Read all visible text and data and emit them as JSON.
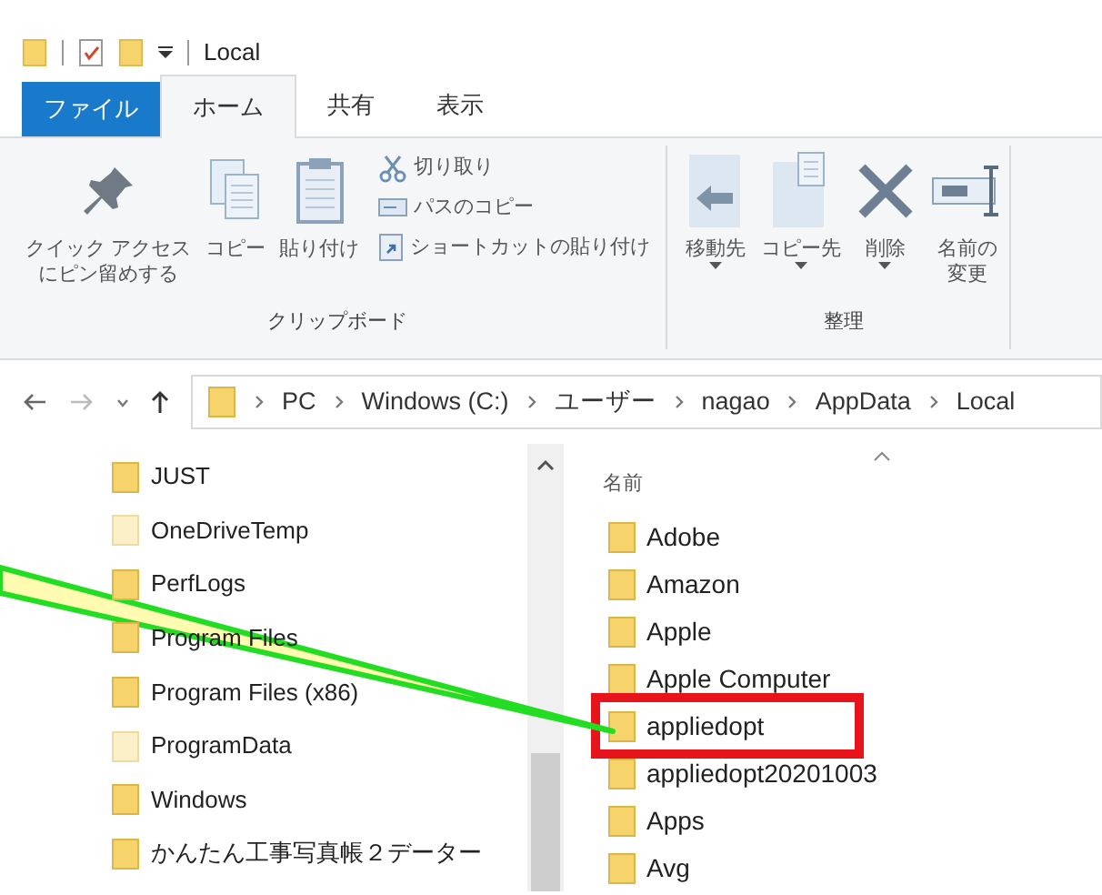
{
  "title_bar": {
    "title": "Local"
  },
  "ribbon_tabs": [
    {
      "label": "ファイル",
      "kind": "file",
      "selected": false
    },
    {
      "label": "ホーム",
      "kind": "tab",
      "selected": true
    },
    {
      "label": "共有",
      "kind": "tab",
      "selected": false
    },
    {
      "label": "表示",
      "kind": "tab",
      "selected": false
    }
  ],
  "ribbon_groups": [
    {
      "label": "クリップボード",
      "large_buttons": [
        {
          "lines": [
            "クイック アクセス",
            "にピン留めする"
          ],
          "kind": "pin"
        },
        {
          "lines": [
            "コピー"
          ],
          "kind": "copy"
        },
        {
          "lines": [
            "貼り付け"
          ],
          "kind": "paste"
        }
      ],
      "small_buttons": [
        {
          "label": "切り取り",
          "kind": "cut"
        },
        {
          "label": "パスのコピー",
          "kind": "path"
        },
        {
          "label": "ショートカットの貼り付け",
          "kind": "shortcut"
        }
      ]
    },
    {
      "label": "整理",
      "large_buttons": [
        {
          "lines": [
            "移動先"
          ],
          "kind": "move",
          "dropdown": true
        },
        {
          "lines": [
            "コピー先"
          ],
          "kind": "copyto",
          "dropdown": true
        },
        {
          "lines": [
            "削除"
          ],
          "kind": "delete",
          "dropdown": true
        },
        {
          "lines": [
            "名前の",
            "変更"
          ],
          "kind": "rename"
        }
      ]
    }
  ],
  "address_bar": {
    "crumbs": [
      "PC",
      "Windows (C:)",
      "ユーザー",
      "nagao",
      "AppData",
      "Local"
    ]
  },
  "nav_pane": {
    "items": [
      {
        "label": "JUST",
        "hidden": false
      },
      {
        "label": "OneDriveTemp",
        "hidden": true
      },
      {
        "label": "PerfLogs",
        "hidden": false
      },
      {
        "label": "Program Files",
        "hidden": false
      },
      {
        "label": "Program Files (x86)",
        "hidden": false
      },
      {
        "label": "ProgramData",
        "hidden": true
      },
      {
        "label": "Windows",
        "hidden": false
      },
      {
        "label": "かんたん工事写真帳２データー",
        "hidden": false
      }
    ]
  },
  "file_list": {
    "columns": [
      "名前"
    ],
    "items": [
      {
        "name": "Adobe"
      },
      {
        "name": "Amazon"
      },
      {
        "name": "Apple"
      },
      {
        "name": "Apple Computer"
      },
      {
        "name": "appliedopt",
        "highlighted": true
      },
      {
        "name": "appliedopt20201003"
      },
      {
        "name": "Apps"
      },
      {
        "name": "Avg"
      }
    ]
  }
}
